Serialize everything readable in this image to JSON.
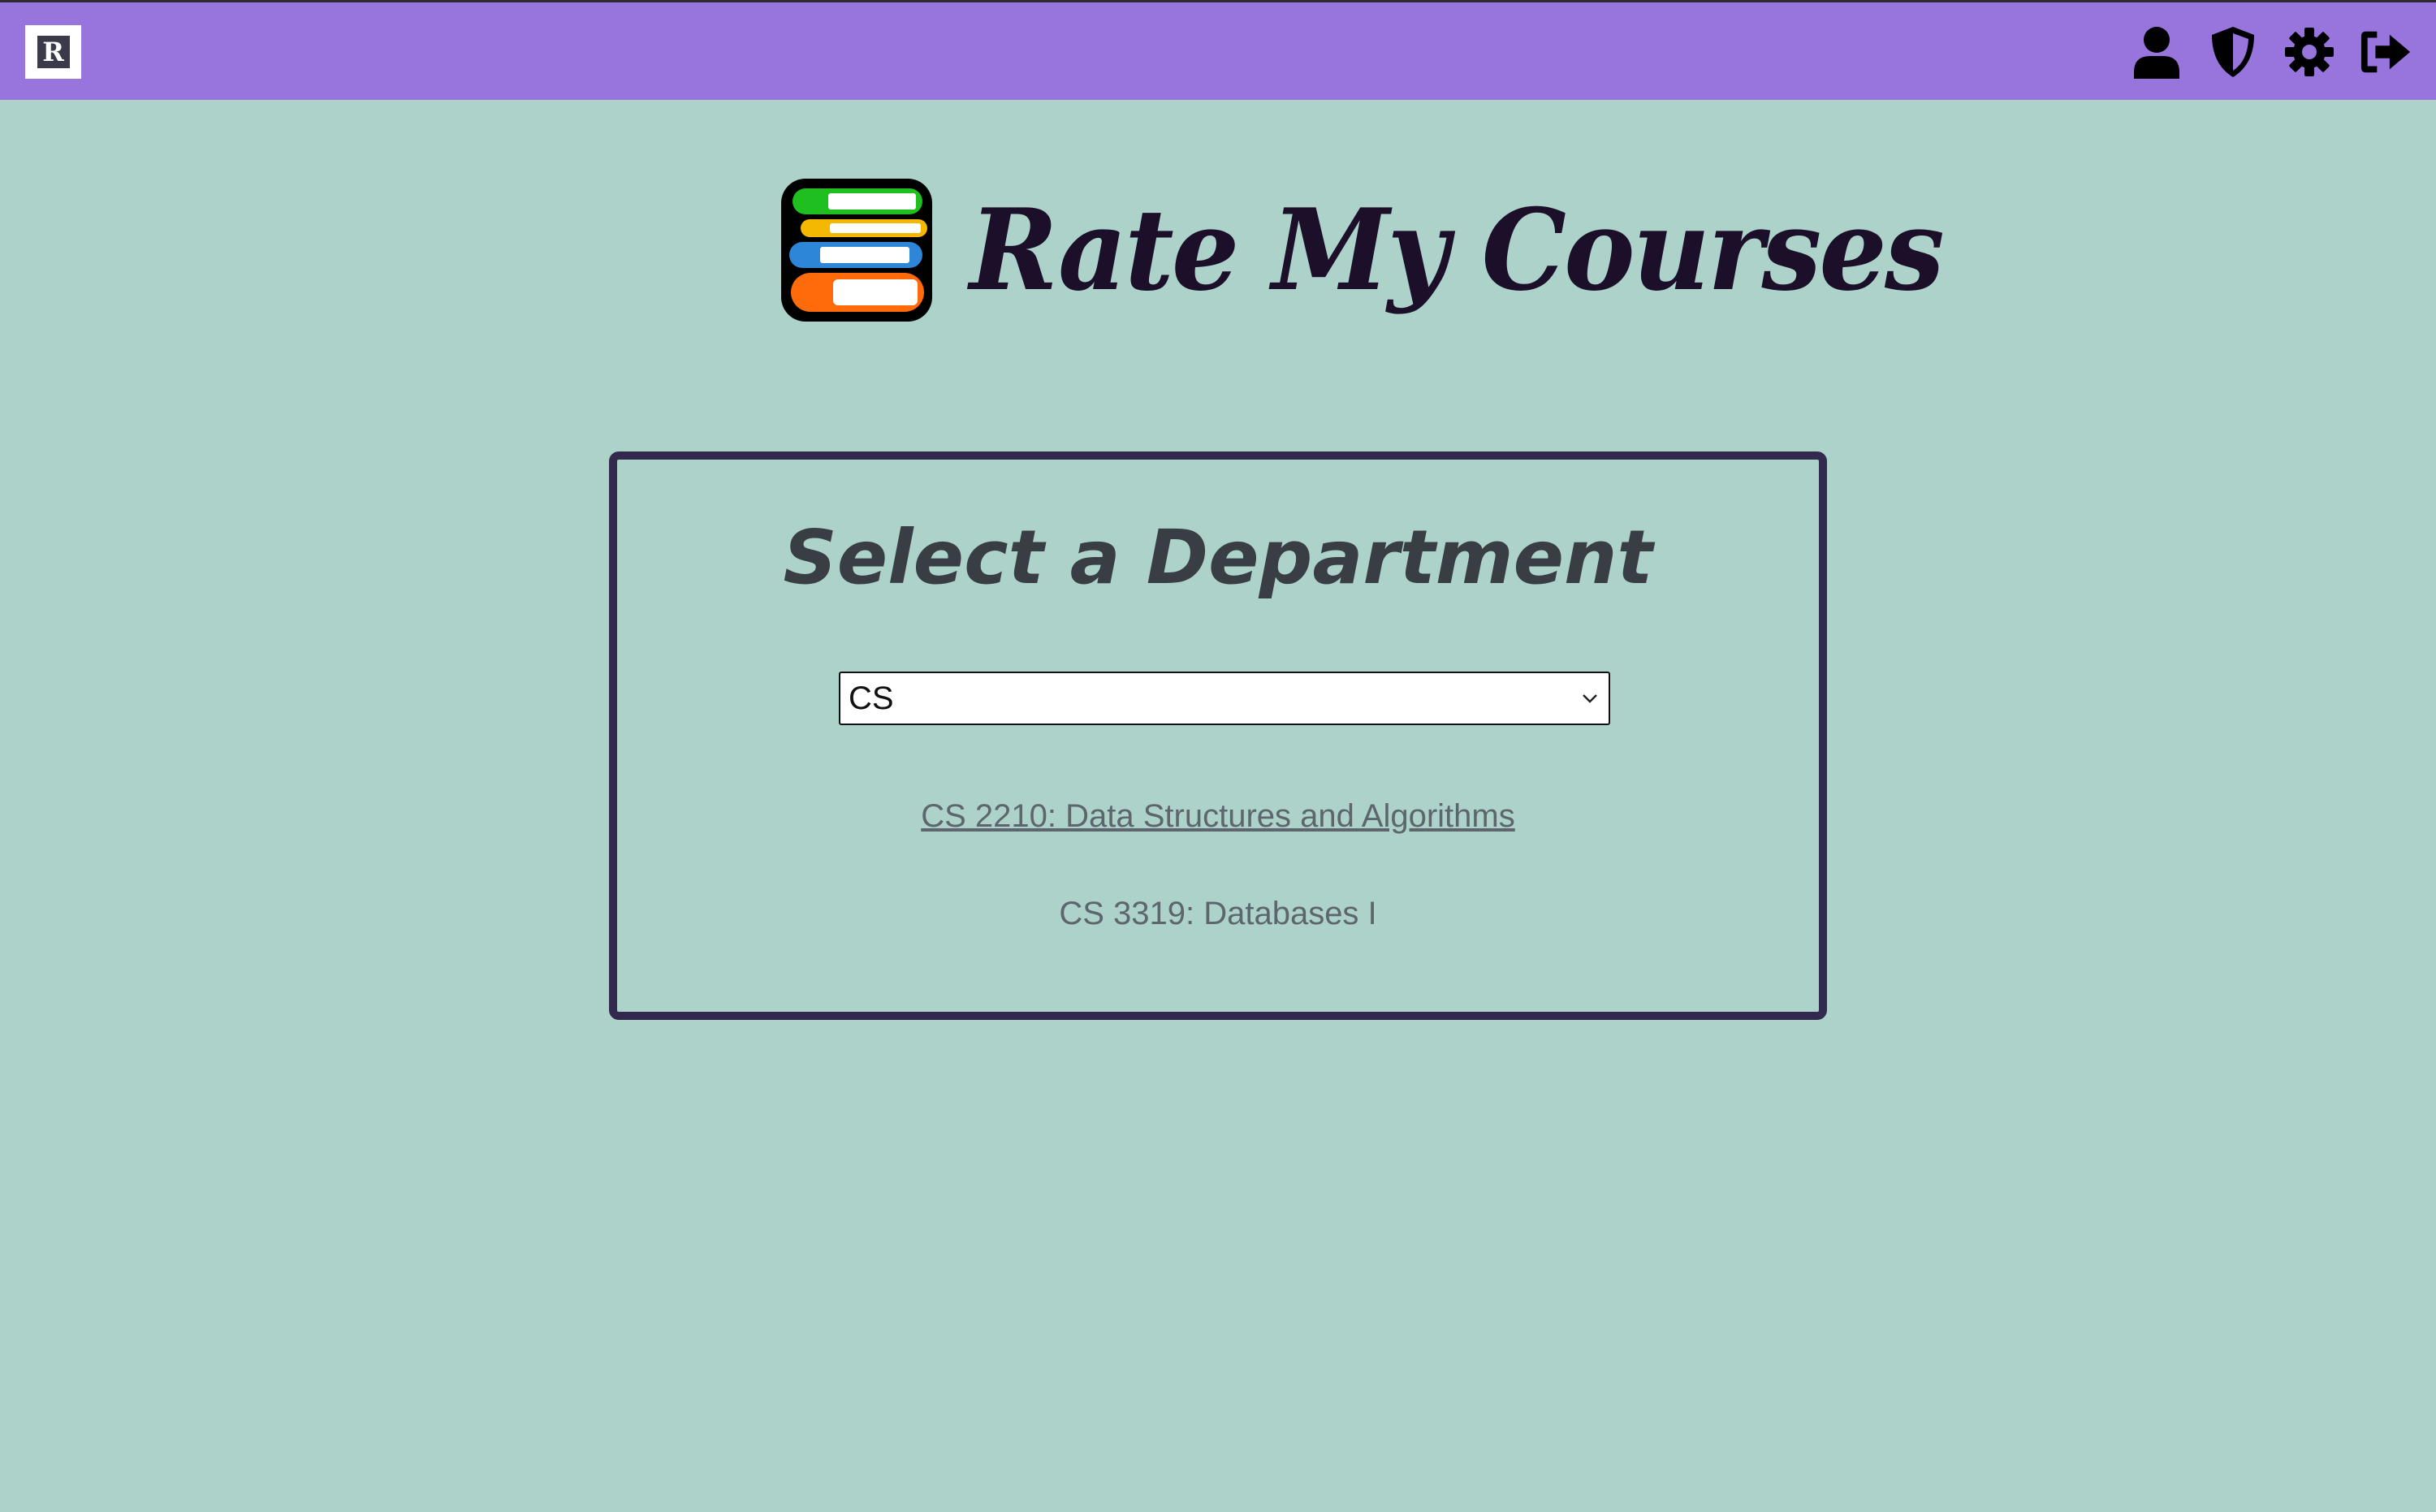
{
  "topbar": {
    "logo_letter": "R",
    "icons": [
      "user-icon",
      "shield-icon",
      "gear-icon",
      "logout-icon"
    ]
  },
  "hero": {
    "title": "Rate My Courses",
    "logo": "books-stack-icon"
  },
  "panel": {
    "title": "Select a Department",
    "department_select": {
      "selected": "CS"
    },
    "courses": [
      {
        "label": "CS 2210: Data Structures and Algorithms",
        "underlined": true
      },
      {
        "label": "CS 3319: Databases I",
        "underlined": false
      }
    ]
  },
  "colors": {
    "background": "#add2ca",
    "topbar": "#9775dd",
    "panel_border": "#33294f",
    "title": "#1c0f2a"
  }
}
